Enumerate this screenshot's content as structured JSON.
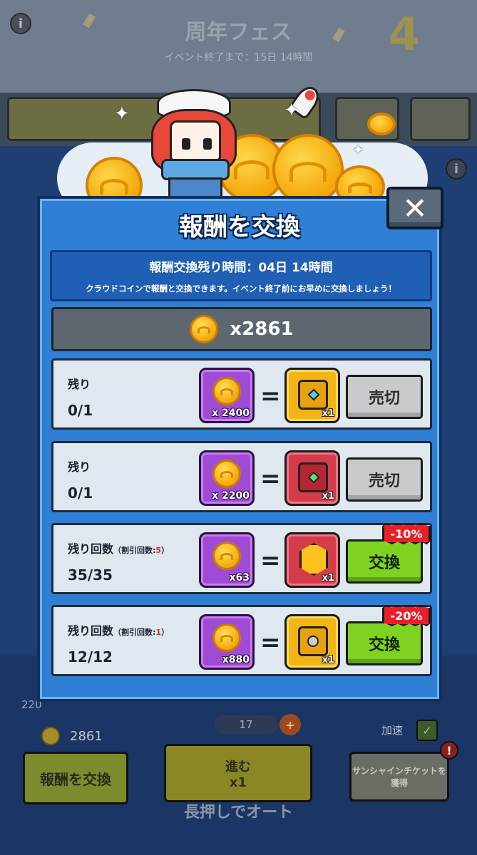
{
  "background": {
    "event_title": "周年フェス",
    "event_remaining": "イベント終了まで：15日 14時間",
    "anniversary_number": "4",
    "bottom_coin_count": "2861",
    "exchange_button": "報酬を交換",
    "go_button": "進む",
    "go_ticket_count": "x1",
    "long_press": "長押しでオート",
    "ticket_counter": "17",
    "speed_label": "加速",
    "sunshine_ticket_button": "サンシャインチケットを獲得",
    "side_value": "220"
  },
  "modal": {
    "title": "報酬を交換",
    "close_label": "✕",
    "remaining_time": "報酬交換残り時間：04日 14時間",
    "description": "クラウドコインで報酬と交換できます。イベント終了前にお早めに交換しましょう！",
    "coin_total": "x2861",
    "rows": [
      {
        "label": "残り",
        "count": "0/1",
        "cost": "x 2400",
        "reward_qty": "x1",
        "button": "売切"
      },
      {
        "label": "残り",
        "count": "0/1",
        "cost": "x 2200",
        "reward_qty": "x1",
        "button": "売切"
      },
      {
        "label": "残り回数",
        "discount_prefix": "（割引回数:",
        "discount_count": "5",
        "discount_suffix": "）",
        "count": "35/35",
        "cost": "x63",
        "reward_qty": "x1",
        "button": "交換",
        "discount_badge": "-10%"
      },
      {
        "label": "残り回数",
        "discount_prefix": "（割引回数:",
        "discount_count": "1",
        "discount_suffix": "）",
        "count": "12/12",
        "cost": "x880",
        "reward_qty": "x1",
        "button": "交換",
        "discount_badge": "-20%"
      }
    ]
  },
  "colors": {
    "modal_blue": "#2f7fd6",
    "exchange_green": "#7ed321",
    "sold_grey": "#c9cacc",
    "cost_purple": "#a04bd6",
    "discount_red": "#e8202a"
  }
}
